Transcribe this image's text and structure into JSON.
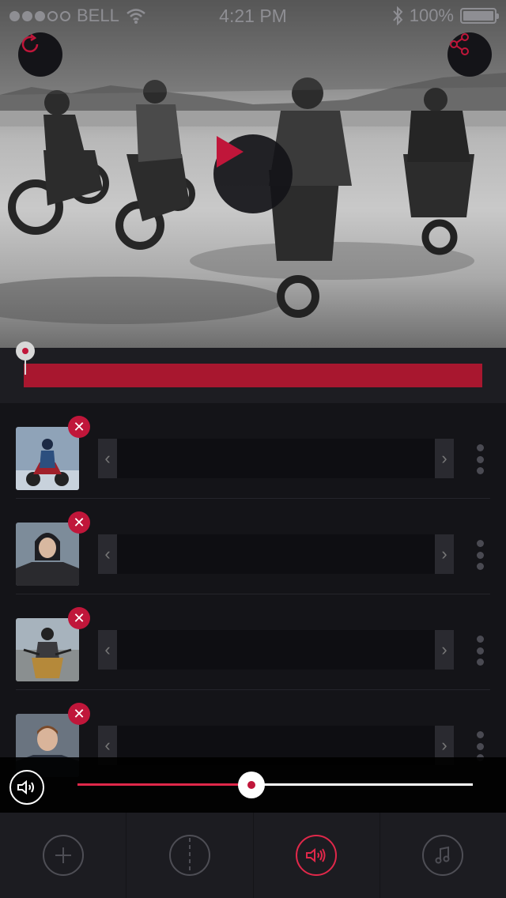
{
  "status_bar": {
    "carrier": "BELL",
    "time": "4:21 PM",
    "battery_percent": "100%",
    "signal_bars_filled": 3,
    "signal_bars_total": 5
  },
  "video": {
    "refresh_icon": "refresh-icon",
    "share_icon": "share-icon",
    "play_icon": "play-icon"
  },
  "timeline": {
    "playhead_position": 0.0
  },
  "tracks": [
    {
      "thumbnail": "rider-on-motorcycle",
      "remove_label": "✕"
    },
    {
      "thumbnail": "man-portrait",
      "remove_label": "✕"
    },
    {
      "thumbnail": "rider-front-view",
      "remove_label": "✕"
    },
    {
      "thumbnail": "young-man-portrait",
      "remove_label": "✕"
    }
  ],
  "volume": {
    "level": 0.44,
    "icon": "speaker-icon"
  },
  "tabs": [
    {
      "name": "add",
      "icon": "plus-icon",
      "active": false
    },
    {
      "name": "split",
      "icon": "split-icon",
      "active": false
    },
    {
      "name": "volume",
      "icon": "speaker-icon",
      "active": true
    },
    {
      "name": "music",
      "icon": "music-note-icon",
      "active": false
    }
  ],
  "colors": {
    "accent": "#c0163a",
    "accent_bright": "#e0284a",
    "background": "#141418"
  }
}
